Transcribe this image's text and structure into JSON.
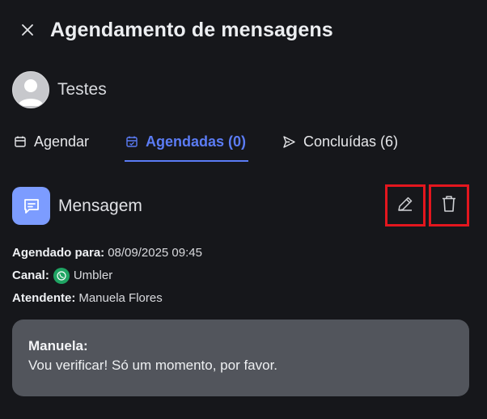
{
  "header": {
    "title": "Agendamento de mensagens",
    "close_icon": "close-icon"
  },
  "contact": {
    "name": "Testes",
    "avatar_icon": "user-avatar-icon"
  },
  "tabs": [
    {
      "label": "Agendar",
      "icon": "calendar-icon",
      "active": false
    },
    {
      "label": "Agendadas (0)",
      "icon": "calendar-check-icon",
      "active": true
    },
    {
      "label": "Concluídas (6)",
      "icon": "send-icon",
      "active": false
    }
  ],
  "message": {
    "label": "Mensagem",
    "icon": "chat-message-icon",
    "actions": {
      "edit_icon": "pencil-icon",
      "delete_icon": "trash-icon"
    },
    "scheduled_for_label": "Agendado para:",
    "scheduled_for_value": "08/09/2025 09:45",
    "channel_label": "Canal:",
    "channel_value": "Umbler",
    "channel_icon": "whatsapp-icon",
    "agent_label": "Atendente:",
    "agent_value": "Manuela Flores",
    "bubble": {
      "author": "Manuela:",
      "text": "Vou verificar! Só um momento, por favor."
    }
  },
  "colors": {
    "background": "#16171b",
    "accent": "#5b7cf5",
    "message_icon_bg": "#7c9cff",
    "bubble_bg": "#52555c",
    "highlight_border": "#e3161e",
    "whatsapp": "#1fa463"
  }
}
